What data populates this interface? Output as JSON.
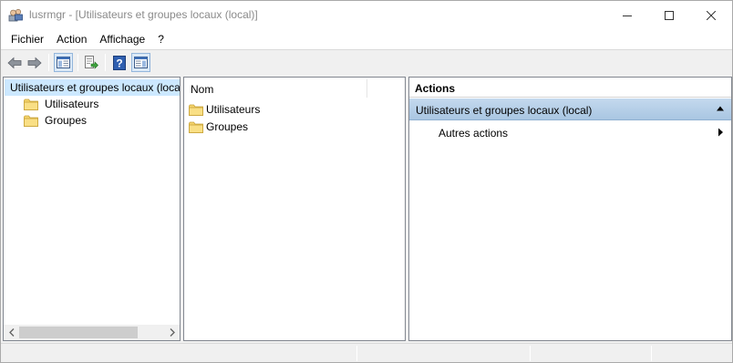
{
  "window": {
    "title": "lusrmgr - [Utilisateurs et groupes locaux (local)]",
    "icon": "users-groups-icon",
    "controls": [
      "minimize-icon",
      "maximize-icon",
      "close-icon"
    ]
  },
  "menu": {
    "items": [
      {
        "label": "Fichier"
      },
      {
        "label": "Action"
      },
      {
        "label": "Affichage"
      },
      {
        "label": "?"
      }
    ]
  },
  "toolbar": {
    "buttons": [
      "back-arrow-icon",
      "forward-arrow-icon",
      "show-tree-icon",
      "export-list-icon",
      "help-icon",
      "show-action-pane-icon"
    ]
  },
  "tree": {
    "root": "Utilisateurs et groupes locaux (local)",
    "children": [
      {
        "label": "Utilisateurs"
      },
      {
        "label": "Groupes"
      }
    ]
  },
  "list": {
    "column_name": "Nom",
    "rows": [
      {
        "label": "Utilisateurs"
      },
      {
        "label": "Groupes"
      }
    ]
  },
  "actions": {
    "title": "Actions",
    "section": "Utilisateurs et groupes locaux (local)",
    "items": [
      {
        "label": "Autres actions"
      }
    ]
  },
  "colors": {
    "selection": "#cce8ff",
    "section_header": "#b6cfe8",
    "folder": "#f5d46c"
  }
}
